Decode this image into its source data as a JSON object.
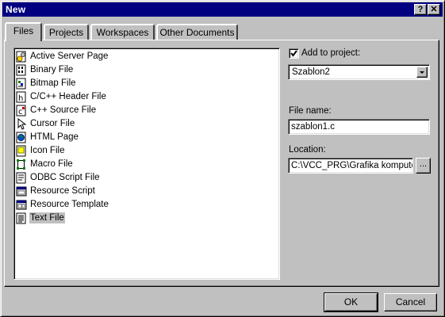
{
  "window": {
    "title": "New",
    "help_glyph": "?",
    "close_glyph": "✕"
  },
  "tabs": [
    {
      "label": "Files",
      "active": true
    },
    {
      "label": "Projects",
      "active": false
    },
    {
      "label": "Workspaces",
      "active": false
    },
    {
      "label": "Other Documents",
      "active": false
    }
  ],
  "file_types": [
    {
      "label": "Active Server Page",
      "icon": "active-server-page-icon"
    },
    {
      "label": "Binary File",
      "icon": "binary-file-icon"
    },
    {
      "label": "Bitmap File",
      "icon": "bitmap-file-icon"
    },
    {
      "label": "C/C++ Header File",
      "icon": "header-file-icon"
    },
    {
      "label": "C++ Source File",
      "icon": "source-file-icon"
    },
    {
      "label": "Cursor File",
      "icon": "cursor-file-icon"
    },
    {
      "label": "HTML Page",
      "icon": "html-page-icon"
    },
    {
      "label": "Icon File",
      "icon": "icon-file-icon"
    },
    {
      "label": "Macro File",
      "icon": "macro-file-icon"
    },
    {
      "label": "ODBC Script File",
      "icon": "odbc-script-icon"
    },
    {
      "label": "Resource Script",
      "icon": "resource-script-icon"
    },
    {
      "label": "Resource Template",
      "icon": "resource-template-icon"
    },
    {
      "label": "Text File",
      "icon": "text-file-icon",
      "selected": true
    }
  ],
  "add_to_project": {
    "label": "Add to project:",
    "checked": true,
    "value": "Szablon2"
  },
  "file_name": {
    "label": "File name:",
    "value": "szablon1.c"
  },
  "location": {
    "label": "Location:",
    "value": "C:\\VCC_PRG\\Grafika komputer",
    "browse_label": "..."
  },
  "buttons": {
    "ok": "OK",
    "cancel": "Cancel"
  },
  "colors": {
    "titlebar": "#000080",
    "face": "#c0c0c0"
  }
}
